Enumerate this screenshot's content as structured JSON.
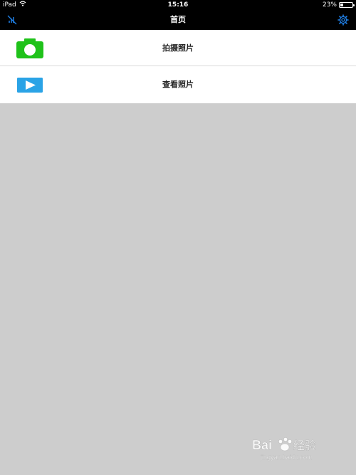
{
  "status_bar": {
    "device": "iPad",
    "time": "15:16",
    "battery": "23%",
    "battery_level": 0.23
  },
  "nav_bar": {
    "title": "首页",
    "left_icon": "no-signal-icon",
    "right_icon": "gear-icon",
    "accent_color": "#1f7fe6"
  },
  "list": {
    "items": [
      {
        "label": "拍摄照片",
        "icon": "camera-icon",
        "icon_color": "#1fc21a"
      },
      {
        "label": "查看照片",
        "icon": "play-icon",
        "icon_color": "#2aa3e6"
      }
    ]
  },
  "colors": {
    "background": "#cdcdcd",
    "bar": "#000000"
  },
  "watermark": {
    "brand": "Baidu 经验",
    "url": "jingyan.baidu.com"
  }
}
